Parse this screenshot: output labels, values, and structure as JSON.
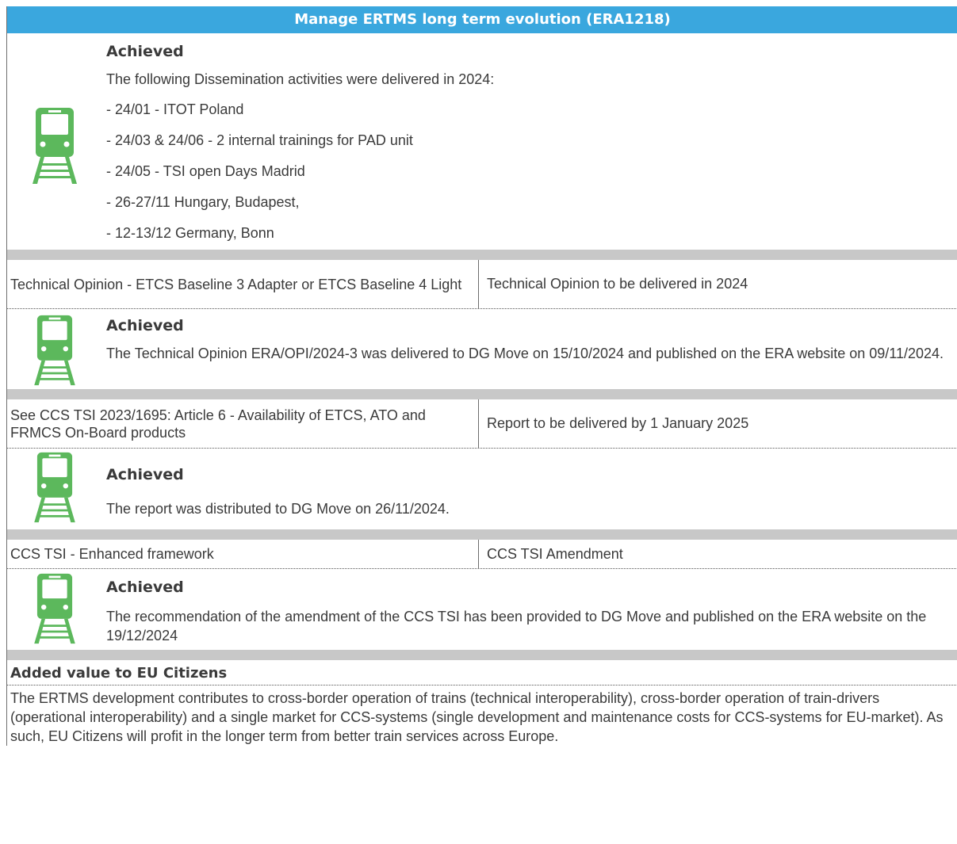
{
  "header": {
    "title": "Manage ERTMS long term evolution (ERA1218)"
  },
  "colors": {
    "header_bg": "#3aa7de",
    "separator": "#c8c8c8",
    "icon_green": "#5cb85c"
  },
  "icon_name": "train-on-tracks-icon",
  "section1": {
    "status": "Achieved",
    "intro": "The following Dissemination activities were delivered in 2024:",
    "items": [
      "- 24/01 - ITOT Poland",
      "- 24/03 & 24/06 - 2 internal trainings for PAD unit",
      "- 24/05 - TSI open Days Madrid",
      "- 26-27/11 Hungary, Budapest,",
      "- 12-13/12 Germany, Bonn"
    ]
  },
  "section2": {
    "left": "Technical Opinion - ETCS Baseline 3 Adapter or ETCS Baseline 4 Light",
    "right": "Technical Opinion to be delivered in 2024",
    "status": "Achieved",
    "text": "The Technical Opinion ERA/OPI/2024-3 was delivered to DG Move on 15/10/2024 and published on the ERA website on 09/11/2024."
  },
  "section3": {
    "left": "See CCS TSI 2023/1695: Article 6 - Availability of ETCS, ATO and FRMCS On-Board products",
    "right": "Report to be delivered by 1 January 2025",
    "status": "Achieved",
    "text": "The report was distributed to DG Move on 26/11/2024."
  },
  "section4": {
    "left": "CCS TSI - Enhanced framework",
    "right": "CCS TSI Amendment",
    "status": "Achieved",
    "text": "The recommendation of the amendment of the CCS TSI has been provided to DG Move and published on the ERA website on the 19/12/2024"
  },
  "added_value": {
    "heading": "Added value to EU Citizens",
    "text": "The ERTMS development contributes to cross-border operation of trains (technical interoperability), cross-border operation of train-drivers (operational interoperability) and a single market for CCS-systems (single development and maintenance costs for CCS-systems for EU-market). As such, EU Citizens will profit in the longer term from better train services across Europe."
  }
}
